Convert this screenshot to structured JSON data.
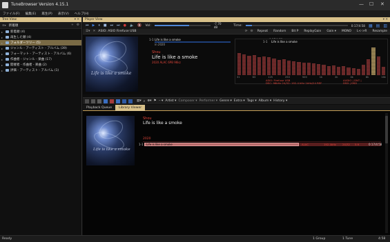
{
  "app": {
    "title": "TuneBrowser Version 4.15.1",
    "window_controls": [
      "—",
      "☐",
      "✕"
    ]
  },
  "menu": [
    "ファイル(F)",
    "編集(E)",
    "再生(P)",
    "表示(V)",
    "ヘルプ(H)"
  ],
  "tree_view": {
    "header": "Tree View",
    "pin": "▾ ✕",
    "toolbar": {
      "label": "新着順",
      "icons": [
        "+",
        "⚙"
      ]
    },
    "items": [
      {
        "label": "新着順 (4)",
        "selected": false
      },
      {
        "label": "再生した順 (4)",
        "selected": false
      },
      {
        "label": "フォルダーツリー (5)",
        "selected": true
      },
      {
        "label": "ジャンル - アーティスト - アルバム (39)",
        "selected": false
      },
      {
        "label": "フォーマット - アーティスト - アルバム (6)",
        "selected": false
      },
      {
        "label": "作曲者 - ジャンル - 楽曲 (17)",
        "selected": false
      },
      {
        "label": "開催者 - 作曲者 - 楽曲 (2)",
        "selected": false
      },
      {
        "label": "評価 - アーティスト - アルバム (1)",
        "selected": false
      }
    ]
  },
  "player_view": {
    "header": "Player View",
    "pin": "▾ ✕",
    "volume": {
      "label": "Vol:",
      "value": "-7.70 dB",
      "fill": 0.62
    },
    "timer": {
      "label": "Time:",
      "value": "0:17/4:58",
      "fill": 0.06
    },
    "device": "ASIO: ASIO Firefuse USB",
    "device_buttons": [
      "Repeat",
      "Random",
      "Bit P",
      "ReplayGain",
      "Gain ▾",
      "MONO",
      "L<->R",
      "Resample"
    ],
    "now_playing": {
      "track_no": "1-1",
      "track_title_small": "Life is like a smoke",
      "year_small": "in 2020",
      "time_small": "0:17/4:58",
      "artist": "Shou",
      "title": "Life is like a smoke",
      "format": "2020  ALAC  6PB 96kz",
      "art_caption": "Life is like a smoke"
    },
    "spectrum": {
      "levels": [
        0.72,
        0.68,
        0.64,
        0.66,
        0.6,
        0.62,
        0.58,
        0.55,
        0.5,
        0.52,
        0.48,
        0.45,
        0.44,
        0.4,
        0.42,
        0.38,
        0.36,
        0.35,
        0.3,
        0.32,
        0.28,
        0.3,
        0.26,
        0.22,
        0.2,
        0.35,
        0.52,
        0.9,
        0.62,
        0.28
      ],
      "freq_labels": [
        "31",
        "63",
        "125",
        "250",
        "500",
        "1k",
        "2k",
        "4k",
        "8k",
        "16k"
      ],
      "status_lines": [
        "ASIO: Firefuse USB",
        "DSC: 96kHz  24/32: 192.4 kHz  1kHz/24  REF"
      ],
      "right_status": [
        "AUDIO  |  DNT  |",
        "DSD  |  DSD"
      ]
    }
  },
  "library_toolbar": {
    "items": [
      "Artist ▾",
      "Composer ▾",
      "Performer ▾",
      "Genre ▾",
      "Extra ▾",
      "Tags ▾",
      "Album ▾",
      "History ▾"
    ]
  },
  "tabs": [
    {
      "label": "Playback Queue",
      "active": false
    },
    {
      "label": "Library Viewer",
      "active": true
    }
  ],
  "library_viewer": {
    "artist": "Shou",
    "album": "Life is like a smoke",
    "year": "2020",
    "art_caption": "Life is like a smoke",
    "tracks": [
      {
        "no": "1-1",
        "title": "Life is like a smoke",
        "format": "ALAC",
        "rate": "192.4kHz",
        "bits": "24/32",
        "extra": "5:9",
        "time": "0:17/4:58"
      }
    ]
  },
  "status_bar": {
    "left": "Ready",
    "groups": "1 Group",
    "tunes": "1 Tune",
    "duration": "4:58"
  },
  "colors": {
    "accent_gold": "#d8c18a",
    "selected_tree": "#7a6a45",
    "title_red": "#e0453a",
    "blue": "#3f7fe0"
  }
}
